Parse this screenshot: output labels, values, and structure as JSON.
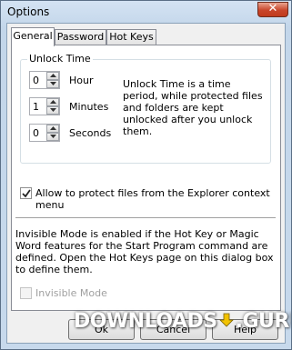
{
  "window": {
    "title": "Options",
    "close_glyph": "✕"
  },
  "tabs": [
    {
      "label": "General",
      "active": true
    },
    {
      "label": "Password",
      "active": false
    },
    {
      "label": "Hot Keys",
      "active": false
    }
  ],
  "unlock_time": {
    "legend": "Unlock Time",
    "hours": {
      "value": "0",
      "label": "Hour"
    },
    "minutes": {
      "value": "1",
      "label": "Minutes"
    },
    "seconds": {
      "value": "0",
      "label": "Seconds"
    },
    "description": "Unlock Time is a time period, while protected files and folders are kept unlocked after you unlock them."
  },
  "explorer_option": {
    "label": "Allow to protect files from the Explorer context menu",
    "checked": true
  },
  "invisible_info": "Invisible Mode is enabled if the Hot Key or Magic Word features for the Start Program command are defined. Open the Hot Keys page on this dialog box to define them.",
  "invisible_mode": {
    "label": "Invisible Mode",
    "checked": false,
    "enabled": false
  },
  "buttons": {
    "ok": "Ok",
    "cancel": "Cancel",
    "help": "Help"
  },
  "watermark": {
    "text_a": "DOWNLOADS",
    "text_b": ".GURU",
    "accent_color": "#f2c200"
  },
  "colors": {
    "close_button": "#c8452a",
    "frame": "#c3d6ea"
  }
}
